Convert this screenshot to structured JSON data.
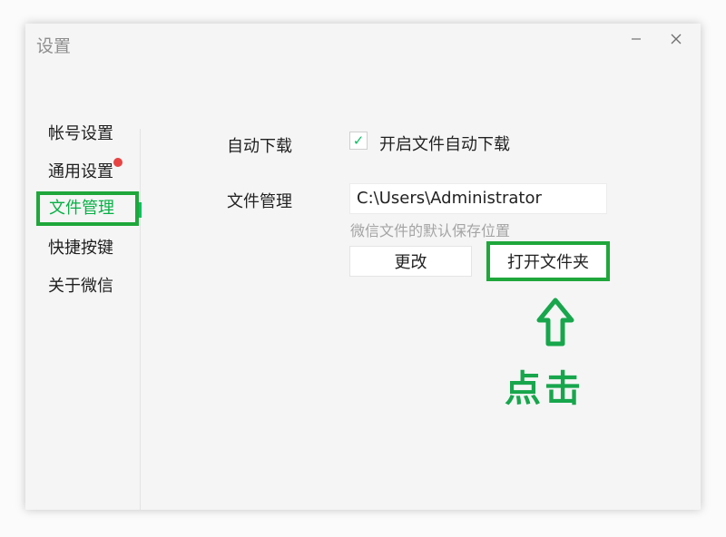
{
  "window": {
    "title": "设置",
    "minimize_icon": "minimize-icon",
    "close_icon": "close-icon"
  },
  "sidebar": {
    "items": [
      {
        "label": "帐号设置"
      },
      {
        "label": "通用设置",
        "badge": "red-dot"
      },
      {
        "label": "文件管理",
        "active": true
      },
      {
        "label": "快捷按键"
      },
      {
        "label": "关于微信"
      }
    ]
  },
  "file_management": {
    "auto_download": {
      "label": "自动下载",
      "checkbox_label": "开启文件自动下载",
      "checked": true
    },
    "folder": {
      "label": "文件管理",
      "path": "C:\\Users\\Administrator",
      "hint": "微信文件的默认保存位置",
      "change_button": "更改",
      "open_folder_button": "打开文件夹"
    }
  },
  "annotation": {
    "callout_text": "点击",
    "arrow_icon": "up-arrow-icon",
    "highlight_color": "#1fa73b"
  },
  "colors": {
    "accent": "#07c160",
    "badge": "#e84343"
  }
}
